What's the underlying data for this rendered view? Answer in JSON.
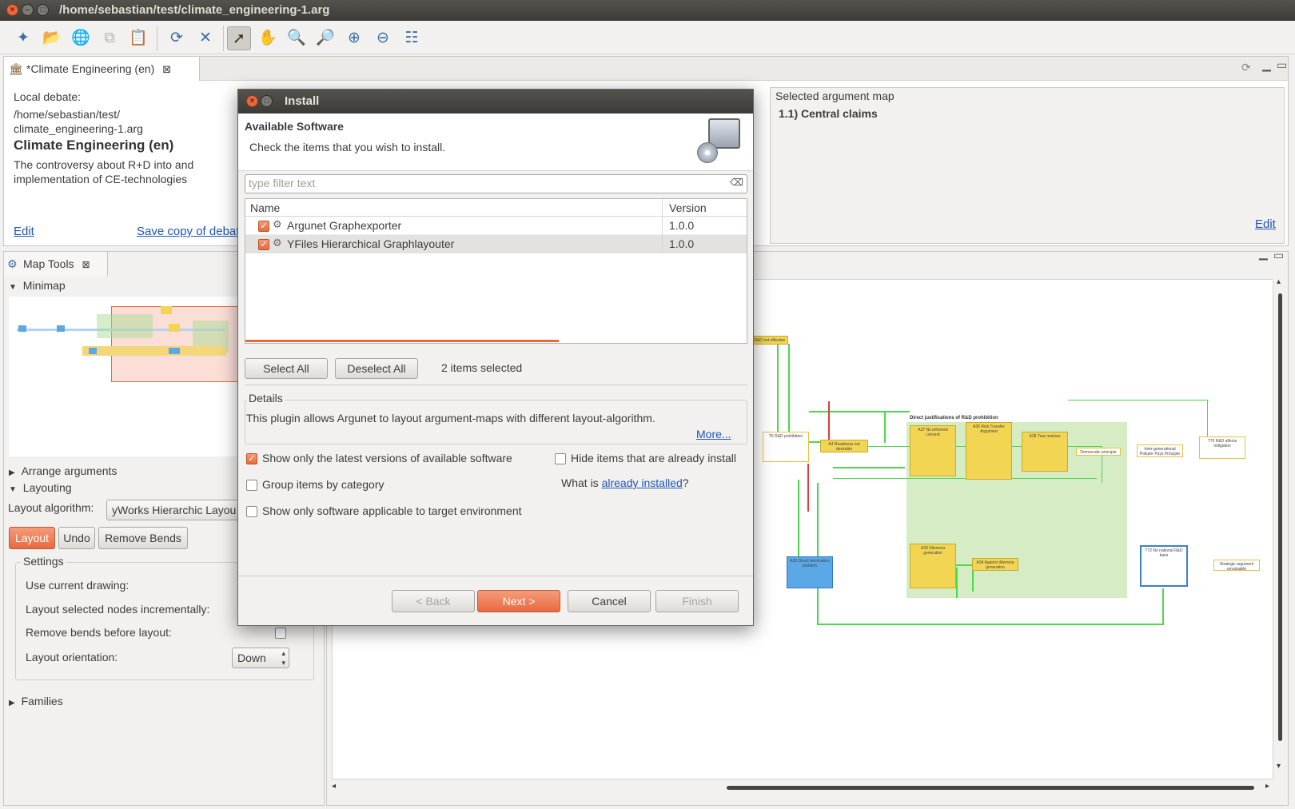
{
  "window": {
    "title": "/home/sebastian/test/climate_engineering-1.arg"
  },
  "editor": {
    "tab_label": "*Climate Engineering (en)",
    "local_debate_label": "Local debate:",
    "path_line1": "/home/sebastian/test/",
    "path_line2": "climate_engineering-1.arg",
    "debate_title": "Climate Engineering (en)",
    "debate_desc_line1": "The controversy about R+D into and",
    "debate_desc_line2": "implementation of CE-technologies",
    "edit_link": "Edit",
    "save_copy_link": "Save copy of debat",
    "selected_map_label": "Selected argument map",
    "selected_map_value": "1.1) Central claims",
    "edit_link2": "Edit"
  },
  "map_tools": {
    "tab_label": "Map Tools",
    "minimap_label": "Minimap",
    "arrange_label": "Arrange arguments",
    "layouting_label": "Layouting",
    "layout_algorithm_label": "Layout algorithm:",
    "layout_algorithm_value": "yWorks Hierarchic Layou",
    "layout_btn": "Layout",
    "undo_btn": "Undo",
    "remove_bends_btn": "Remove Bends",
    "settings_label": "Settings",
    "use_current_drawing": "Use current drawing:",
    "layout_incremental": "Layout selected nodes incrementally:",
    "remove_bends_before": "Remove bends before layout:",
    "layout_orientation": "Layout orientation:",
    "orientation_value": "Down",
    "families_label": "Families"
  },
  "dialog": {
    "title": "Install",
    "heading": "Available Software",
    "subheading": "Check the items that you wish to install.",
    "filter_placeholder": "type filter text",
    "col_name": "Name",
    "col_version": "Version",
    "items": [
      {
        "name": "Argunet Graphexporter",
        "version": "1.0.0",
        "checked": true
      },
      {
        "name": "YFiles Hierarchical Graphlayouter",
        "version": "1.0.0",
        "checked": true
      }
    ],
    "select_all": "Select All",
    "deselect_all": "Deselect All",
    "selected_count": "2 items selected",
    "details_label": "Details",
    "details_text": "This plugin allows Argunet to layout argument-maps with different layout-algorithm.",
    "more_link": "More...",
    "opt_latest": "Show only the latest versions of available software",
    "opt_hide_installed": "Hide items that are already install",
    "opt_group": "Group items by category",
    "what_is": "What is ",
    "already_installed_link": "already installed",
    "question_mark": "?",
    "opt_applicable": "Show only software applicable to target environment",
    "back_btn": "< Back",
    "next_btn": "Next >",
    "cancel_btn": "Cancel",
    "finish_btn": "Finish"
  },
  "map": {
    "group_title": "Direct justifications of R&D prohibition",
    "nodes": [
      {
        "label": "A7 R&D not effective"
      },
      {
        "label": "T6 R&D prohibition"
      },
      {
        "label": "A4 Readiness not desirable"
      },
      {
        "label": "A37 No informed consent"
      },
      {
        "label": "A36 Risk Transfer Argument"
      },
      {
        "label": "A38 True motives"
      },
      {
        "label": "Democratic principle"
      },
      {
        "label": "Inter-generational Polluter Pays Principle"
      },
      {
        "label": "T70 R&D affects mitigation"
      },
      {
        "label": "A30 Direct termination problem"
      },
      {
        "label": "A39 Dilemma generation"
      },
      {
        "label": "A34 Against dilemma generation"
      },
      {
        "label": "T72 No national R&D bans"
      },
      {
        "label": "Strategic argument unvaluable"
      }
    ]
  },
  "colors": {
    "accent": "#e9693f",
    "link": "#1e56b9",
    "titlebar": "#3c3b37"
  }
}
